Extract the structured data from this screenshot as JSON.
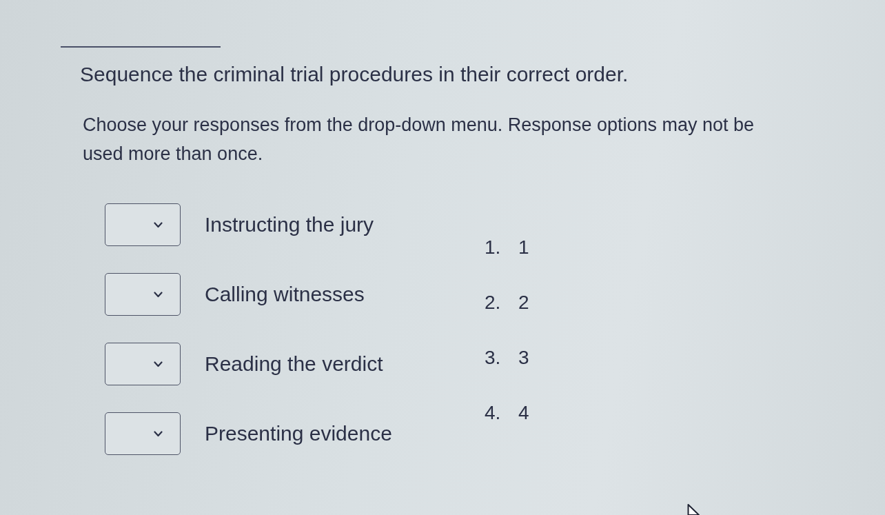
{
  "question": {
    "title": "Sequence the criminal trial procedures in their correct order.",
    "instructions": "Choose your responses from the drop-down menu. Response options may not be used more than once.",
    "items": [
      {
        "label": "Instructing the jury"
      },
      {
        "label": "Calling witnesses"
      },
      {
        "label": "Reading the verdict"
      },
      {
        "label": "Presenting evidence"
      }
    ],
    "options": [
      {
        "number": "1.",
        "text": "1"
      },
      {
        "number": "2.",
        "text": "2"
      },
      {
        "number": "3.",
        "text": "3"
      },
      {
        "number": "4.",
        "text": "4"
      }
    ]
  }
}
